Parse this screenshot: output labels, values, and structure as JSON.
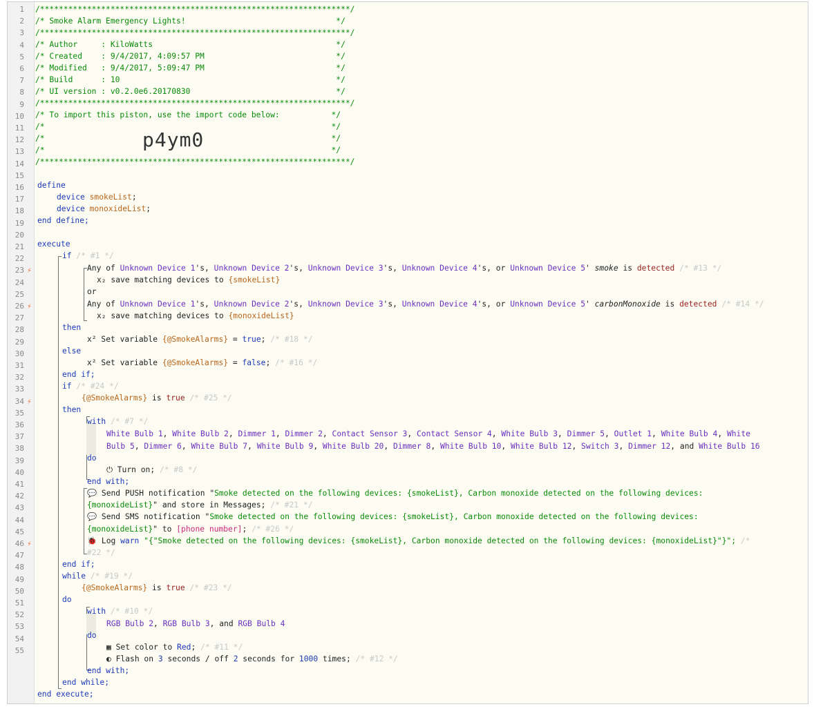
{
  "header": {
    "l1": "/******************************************************************/",
    "l2": "/* Smoke Alarm Emergency Lights!                                */",
    "l3": "/******************************************************************/",
    "l4": "/* Author     : KiloWatts                                       */",
    "l5": "/* Created    : 9/4/2017, 4:09:57 PM                            */",
    "l6": "/* Modified   : 9/4/2017, 5:09:47 PM                            */",
    "l7": "/* Build      : 10                                              */",
    "l8": "/* UI version : v0.2.0e6.20170830                               */",
    "l9": "/******************************************************************/",
    "l10": "/* To import this piston, use the import code below:           */",
    "l11": "/*                                                             */",
    "l12": "/*                                                             */",
    "l13": "/*                                                             */",
    "l14": "/******************************************************************/",
    "import_code": "p4ym0"
  },
  "line_numbers": [
    "1",
    "2",
    "3",
    "4",
    "5",
    "6",
    "7",
    "8",
    "9",
    "10",
    "11",
    "12",
    "13",
    "14",
    "15",
    "16",
    "17",
    "18",
    "19",
    "20",
    "21",
    "22",
    "23",
    "24",
    "25",
    "26",
    "27",
    "28",
    "29",
    "30",
    "31",
    "32",
    "33",
    "34",
    "35",
    "36",
    "37",
    "38",
    "39",
    "40",
    "41",
    "42",
    "43",
    "44",
    "45",
    "46",
    "47",
    "48",
    "49",
    "50",
    "51",
    "52",
    "53",
    "54",
    "55"
  ],
  "kw": {
    "define": "define",
    "device": "device",
    "end_define": "end define;",
    "execute": "execute",
    "if": "if",
    "or": "or",
    "then": "then",
    "else": "else",
    "end_if": "end if;",
    "with": "with",
    "do": "do",
    "end_with": "end with;",
    "while": "while",
    "end_while": "end while;",
    "end_execute": "end execute;",
    "is": "is",
    "and": "and"
  },
  "vars": {
    "smokeList": "smokeList",
    "monoxideList": "monoxideList",
    "smokeList_b": "{smokeList}",
    "monoxideList_b": "{monoxideList}",
    "smoke_alarms": "{@SmokeAlarms}"
  },
  "comments": {
    "c1": "/* #1 */",
    "c13": "/* #13 */",
    "c14": "/* #14 */",
    "c18": "/* #18 */",
    "c16": "/* #16 */",
    "c24": "/* #24 */",
    "c25": "/* #25 */",
    "c7": "/* #7 */",
    "c8": "/* #8 */",
    "c21": "/* #21 */",
    "c26": "/* #26 */",
    "c22a": "/*",
    "c22b": "#22 */",
    "c19": "/* #19 */",
    "c23": "/* #23 */",
    "c10": "/* #10 */",
    "c11": "/* #11 */",
    "c12": "/* #12 */"
  },
  "cond": {
    "any_of": "Any of ",
    "dev1": "Unknown Device 1",
    "dev2": "Unknown Device 2",
    "dev3": "Unknown Device 3",
    "dev4": "Unknown Device 4",
    "dev5": "Unknown Device 5",
    "s1": "'s, ",
    "s4": "'s, or ",
    "s5": "' ",
    "smoke": "smoke",
    "carbon": "carbonMonoxide",
    "detected": "detected",
    "save_matching": "save matching devices to ",
    "x2": "x₂"
  },
  "stmts": {
    "set_var": "x² Set variable ",
    "eq": " = ",
    "true": "true",
    "false": "false",
    "semi": ";",
    "turn_on": "Turn on;",
    "power_icon": "⏻",
    "bell_icon": "💬",
    "bug_icon": "🐞",
    "color_icon": "▦",
    "toggle_icon": "◐",
    "push_prefix": "Send PUSH notification \"",
    "push_msg": "Smoke detected on the following devices: {smokeList}, Carbon monoxide detected on the following devices:",
    "push_msg2": "{monoxideList}",
    "push_tail": "\" and store in Messages;",
    "sms_prefix": "Send SMS notification \"",
    "sms_msg": "Smoke detected on the following devices: {smokeList}, Carbon monoxide detected on the following devices:",
    "sms_msg2": "{monoxideList}",
    "sms_tail": "\" to ",
    "phone": "[phone number]",
    "log_prefix": "Log ",
    "warn": "warn",
    "log_msg": "\"{\"Smoke detected on the following devices: {smokeList}, Carbon monoxide detected on the following devices: {monoxideList}\"}\";",
    "set_color": "Set color to ",
    "red": "Red",
    "flash": "Flash on ",
    "three": "3",
    "seconds_off": " seconds / off ",
    "two": "2",
    "seconds_for": " seconds for ",
    "times_n": "1000",
    "times": " times;",
    "to": " to "
  },
  "with1_devices": {
    "line1": [
      "White Bulb 1",
      "White Bulb 2",
      "Dimmer 1",
      "Dimmer 2",
      "Contact Sensor 3",
      "Contact Sensor 4",
      "White Bulb 3",
      "Dimmer 5",
      "Outlet 1",
      "White Bulb 4",
      "White"
    ],
    "line2": [
      "Bulb 5",
      "Dimmer 6",
      "White Bulb 7",
      "White Bulb 9",
      "White Bulb 20",
      "Dimmer 8",
      "White Bulb 10",
      "White Bulb 12",
      "Switch 3",
      "Dimmer 12"
    ],
    "last": "White Bulb 16"
  },
  "with2_devices": [
    "RGB Bulb 2",
    "RGB Bulb 3",
    "RGB Bulb 4"
  ],
  "colors": {
    "keyword": "#1c38b8",
    "device": "#6a2fc0",
    "variable": "#b8661c",
    "string": "#0a8a0a",
    "comment_faded": "#c8c8c8",
    "trigger": "#e8733a"
  }
}
